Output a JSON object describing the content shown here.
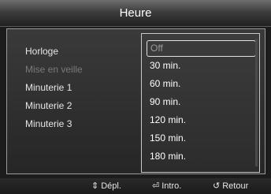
{
  "header": {
    "title": "Heure"
  },
  "menu": {
    "items": [
      {
        "label": "Horloge"
      },
      {
        "label": "Mise en veille"
      },
      {
        "label": "Minuterie 1"
      },
      {
        "label": "Minuterie 2"
      },
      {
        "label": "Minuterie 3"
      }
    ]
  },
  "dropdown": {
    "options": [
      {
        "label": "Off"
      },
      {
        "label": "30 min."
      },
      {
        "label": "60 min."
      },
      {
        "label": "90 min."
      },
      {
        "label": "120 min."
      },
      {
        "label": "150 min."
      },
      {
        "label": "180 min."
      }
    ]
  },
  "footer": {
    "move_label": "Dépl.",
    "enter_label": "Intro.",
    "return_label": "Retour"
  },
  "icons": {
    "move": "up-down-arrow-icon",
    "enter": "enter-icon",
    "return": "return-icon"
  }
}
